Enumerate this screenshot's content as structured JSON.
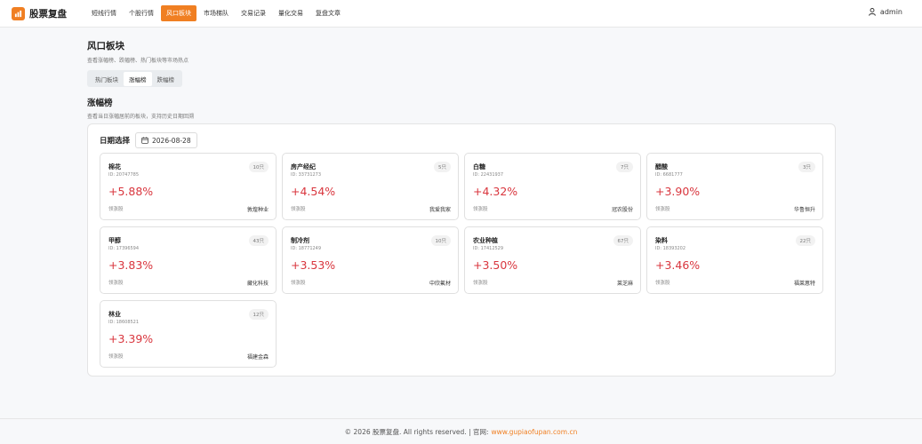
{
  "app": {
    "name": "股票复盘",
    "logo_glyph": "📈"
  },
  "nav": {
    "items": [
      {
        "label": "短线行情",
        "active": false
      },
      {
        "label": "个股行情",
        "active": false
      },
      {
        "label": "风口板块",
        "active": true
      },
      {
        "label": "市场梯队",
        "active": false
      },
      {
        "label": "交易记录",
        "active": false
      },
      {
        "label": "量化交易",
        "active": false
      },
      {
        "label": "复盘文章",
        "active": false
      }
    ]
  },
  "user": {
    "name": "admin",
    "icon": "user-icon"
  },
  "page": {
    "title": "风口板块",
    "subtitle": "查看涨幅榜、跌幅榜、热门板块等市场热点",
    "tabs": [
      {
        "label": "热门板块",
        "active": false
      },
      {
        "label": "涨幅榜",
        "active": true
      },
      {
        "label": "跌幅榜",
        "active": false
      }
    ]
  },
  "section": {
    "title": "涨幅榜",
    "subtitle": "查看当日涨幅居前的板块，支持历史日期回溯",
    "date_label": "日期选择",
    "date_value": "2026-08-28",
    "date_icon": "calendar-icon"
  },
  "cards": [
    {
      "name": "棉花",
      "id": "ID: 20747785",
      "badge": "10只",
      "pct": "+5.88%",
      "lead_label": "领涨股",
      "lead_stock": "敦煌种业"
    },
    {
      "name": "房产经纪",
      "id": "ID: 33731273",
      "badge": "5只",
      "pct": "+4.54%",
      "lead_label": "领涨股",
      "lead_stock": "我爱我家"
    },
    {
      "name": "白糖",
      "id": "ID: 22431937",
      "badge": "7只",
      "pct": "+4.32%",
      "lead_label": "领涨股",
      "lead_stock": "冠农股份"
    },
    {
      "name": "醋酸",
      "id": "ID: 6681777",
      "badge": "3只",
      "pct": "+3.90%",
      "lead_label": "领涨股",
      "lead_stock": "华鲁恒升"
    },
    {
      "name": "甲醇",
      "id": "ID: 17396594",
      "badge": "43只",
      "pct": "+3.83%",
      "lead_label": "领涨股",
      "lead_stock": "藏化科技"
    },
    {
      "name": "制冷剂",
      "id": "ID: 18771249",
      "badge": "10只",
      "pct": "+3.53%",
      "lead_label": "领涨股",
      "lead_stock": "中欣氟材"
    },
    {
      "name": "农业种植",
      "id": "ID: 17412529",
      "badge": "67只",
      "pct": "+3.50%",
      "lead_label": "领涨股",
      "lead_stock": "莱芝麻"
    },
    {
      "name": "染料",
      "id": "ID: 18393202",
      "badge": "22只",
      "pct": "+3.46%",
      "lead_label": "领涨股",
      "lead_stock": "福莱蒽特"
    },
    {
      "name": "林业",
      "id": "ID: 18608521",
      "badge": "12只",
      "pct": "+3.39%",
      "lead_label": "领涨股",
      "lead_stock": "福建金森"
    }
  ],
  "footer": {
    "text": "© 2026 股票复盘. All rights reserved. | 官网:",
    "link": "www.gupiaofupan.com.cn"
  },
  "colors": {
    "accent": "#f07f22",
    "up": "#d9363e"
  }
}
